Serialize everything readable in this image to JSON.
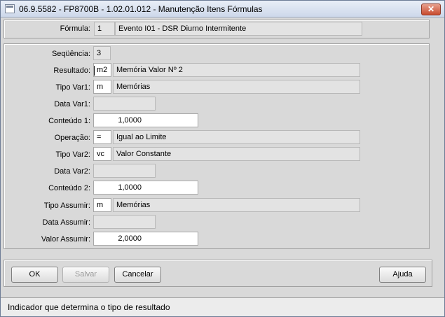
{
  "window": {
    "title": "06.9.5582 - FP8700B - 1.02.01.012 - Manutenção Itens Fórmulas",
    "close_glyph": "✕"
  },
  "header": {
    "formula_label": "Fórmula:",
    "formula_code": "1",
    "formula_desc": "Evento I01 - DSR Diurno Intermitente"
  },
  "form": {
    "sequencia_label": "Seqüência:",
    "sequencia_value": "3",
    "resultado_label": "Resultado:",
    "resultado_code": "m2",
    "resultado_desc": "Memória Valor Nº 2",
    "tipovar1_label": "Tipo Var1:",
    "tipovar1_code": "m",
    "tipovar1_desc": "Memórias",
    "datavar1_label": "Data Var1:",
    "datavar1_value": "",
    "conteudo1_label": "Conteúdo 1:",
    "conteudo1_value": "1,0000",
    "operacao_label": "Operação:",
    "operacao_code": "=",
    "operacao_desc": "Igual ao Limite",
    "tipovar2_label": "Tipo Var2:",
    "tipovar2_code": "vc",
    "tipovar2_desc": "Valor Constante",
    "datavar2_label": "Data Var2:",
    "datavar2_value": "",
    "conteudo2_label": "Conteúdo 2:",
    "conteudo2_value": "1,0000",
    "tipoassumir_label": "Tipo Assumir:",
    "tipoassumir_code": "m",
    "tipoassumir_desc": "Memórias",
    "dataassumir_label": "Data Assumir:",
    "dataassumir_value": "",
    "valorassumir_label": "Valor Assumir:",
    "valorassumir_value": "2,0000"
  },
  "buttons": {
    "ok": "OK",
    "salvar": "Salvar",
    "cancelar": "Cancelar",
    "ajuda": "Ajuda"
  },
  "status": {
    "text": "Indicador que determina o tipo de resultado"
  }
}
